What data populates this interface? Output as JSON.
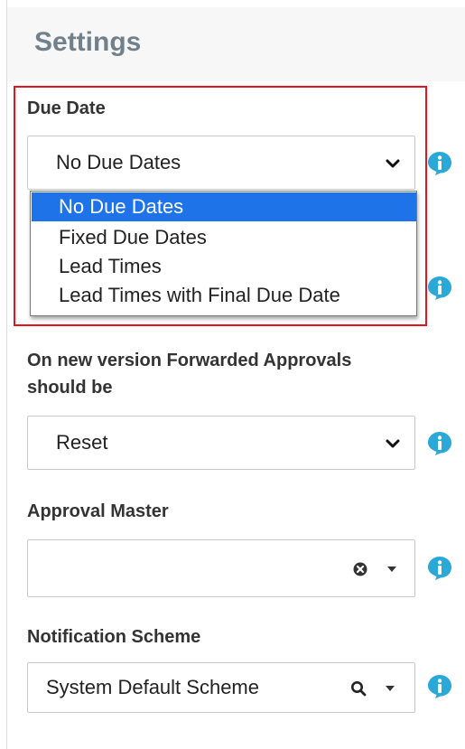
{
  "header": {
    "title": "Settings"
  },
  "due_date": {
    "label": "Due Date",
    "selected": "No Due Dates",
    "options": [
      "No Due Dates",
      "Fixed Due Dates",
      "Lead Times",
      "Lead Times with Final Due Date"
    ]
  },
  "forwarded_approvals": {
    "label_line1": "On new version Forwarded Approvals",
    "label_line2": "should be",
    "selected": "Reset"
  },
  "approval_master": {
    "label": "Approval Master",
    "value": ""
  },
  "notification_scheme": {
    "label": "Notification Scheme",
    "value": "System Default Scheme"
  },
  "colors": {
    "accent": "#1e73e8",
    "info_icon": "#2aa8d8",
    "highlight": "#e1151b",
    "title": "#72808c"
  },
  "icons": [
    "chevron-down-icon",
    "info-icon",
    "clear-icon",
    "caret-down-icon",
    "search-icon"
  ]
}
